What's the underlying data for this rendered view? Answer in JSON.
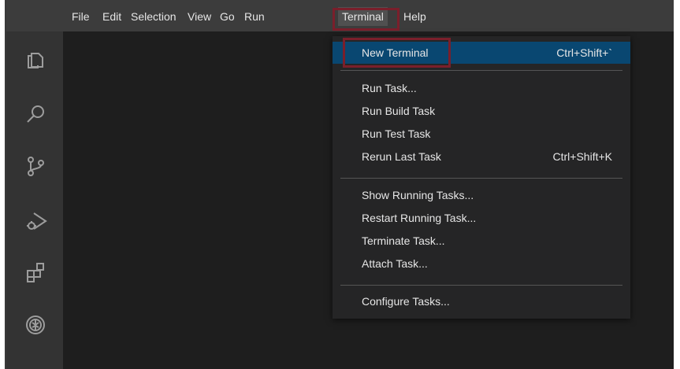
{
  "menubar": {
    "items": [
      "File",
      "Edit",
      "Selection",
      "View",
      "Go",
      "Run",
      "Terminal",
      "Help"
    ],
    "active": "Terminal"
  },
  "activity_bar": {
    "icons": [
      "explorer-icon",
      "search-icon",
      "source-control-icon",
      "run-debug-icon",
      "extensions-icon",
      "remote-icon"
    ]
  },
  "terminal_menu": {
    "items": [
      {
        "label": "New Terminal",
        "shortcut": "Ctrl+Shift+`"
      },
      {
        "label": "Run Task...",
        "shortcut": ""
      },
      {
        "label": "Run Build Task",
        "shortcut": ""
      },
      {
        "label": "Run Test Task",
        "shortcut": ""
      },
      {
        "label": "Rerun Last Task",
        "shortcut": "Ctrl+Shift+K"
      },
      {
        "label": "Show Running Tasks...",
        "shortcut": ""
      },
      {
        "label": "Restart Running Task...",
        "shortcut": ""
      },
      {
        "label": "Terminate Task...",
        "shortcut": ""
      },
      {
        "label": "Attach Task...",
        "shortcut": ""
      },
      {
        "label": "Configure Tasks...",
        "shortcut": ""
      }
    ],
    "highlighted": "New Terminal"
  },
  "colors": {
    "titlebar": "#3c3c3c",
    "editor_bg": "#1e1e1e",
    "activity_bar": "#333333",
    "menu_bg": "#252526",
    "selection": "#094771",
    "annotation_box": "#7a1f2b"
  }
}
